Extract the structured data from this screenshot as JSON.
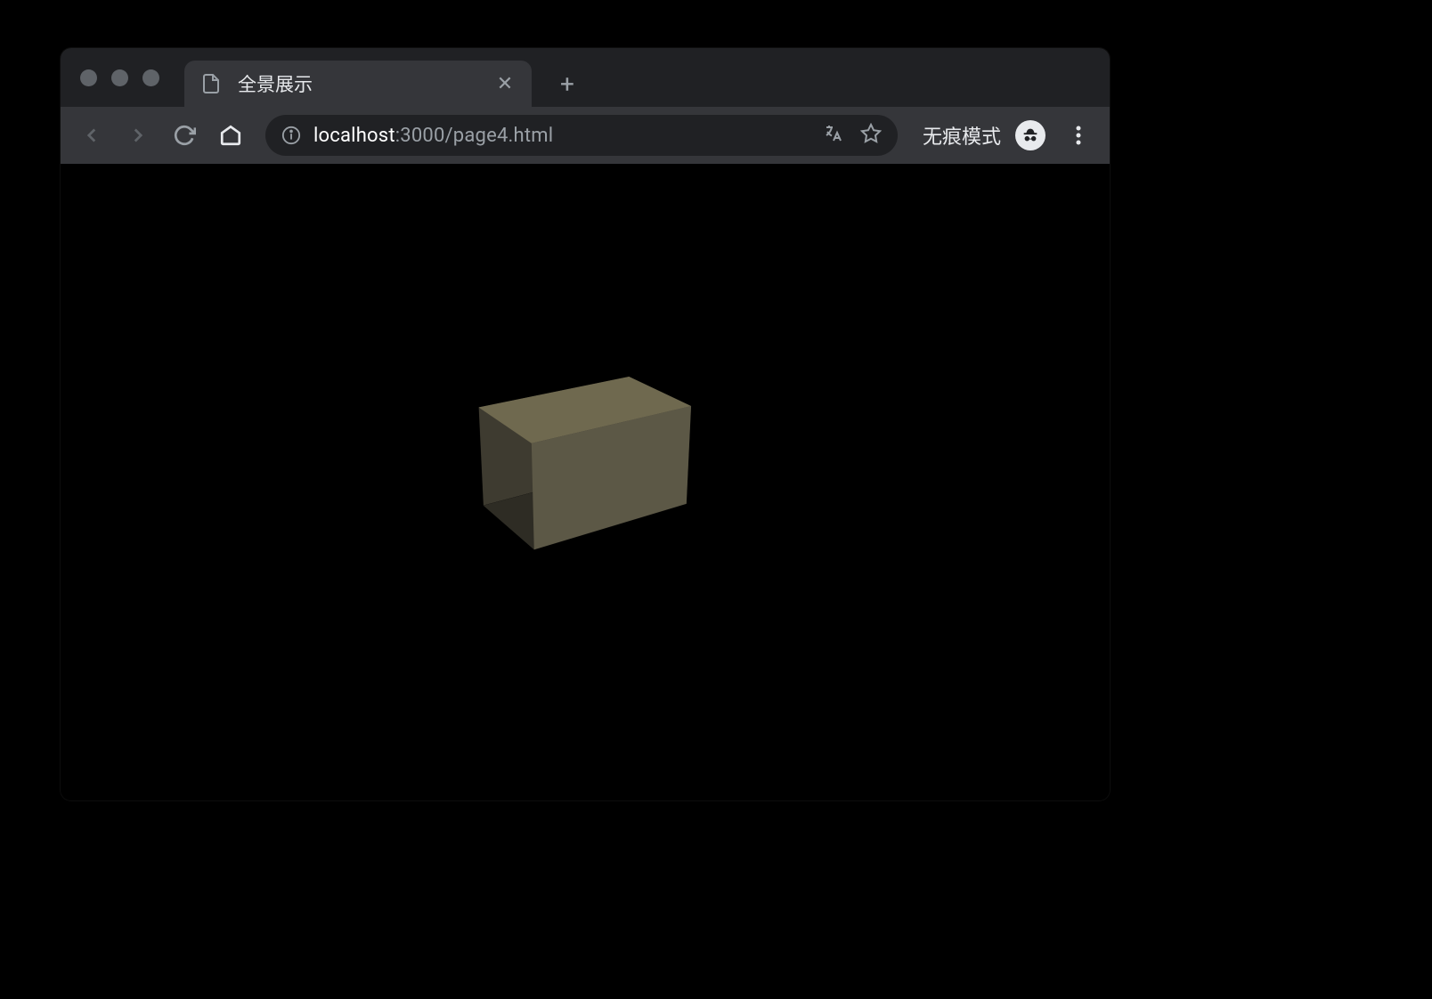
{
  "tab": {
    "title": "全景展示",
    "favicon_name": "file-icon"
  },
  "toolbar": {
    "url_host": "localhost",
    "url_port_path": ":3000/page4.html",
    "incognito_label": "无痕模式"
  }
}
